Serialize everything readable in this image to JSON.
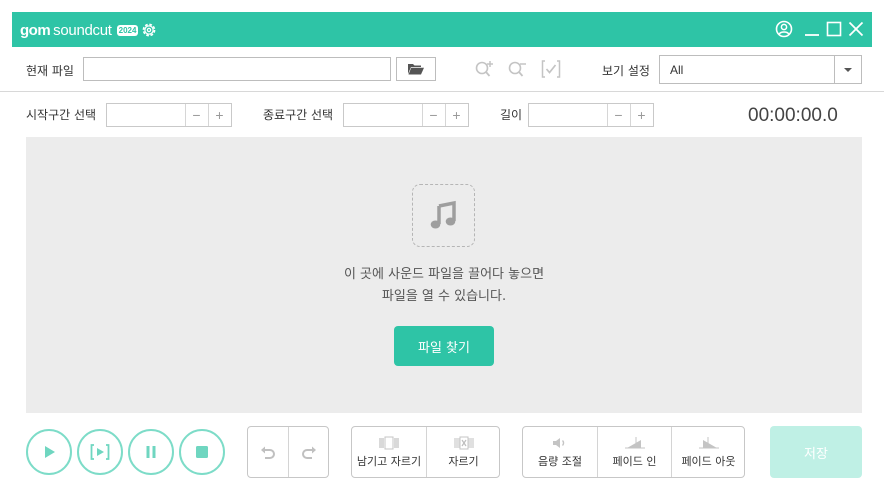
{
  "titlebar": {
    "logo_bold": "gom",
    "logo_light": "soundcut",
    "logo_badge": "2024"
  },
  "file_row": {
    "current_file_label": "현재 파일",
    "current_file_value": "",
    "view_settings_label": "보기 설정",
    "view_settings_value": "All"
  },
  "range_row": {
    "start_label": "시작구간 선택",
    "end_label": "종료구간 선택",
    "length_label": "길이",
    "minus": "−",
    "plus": "+",
    "time_display": "00:00:00.0"
  },
  "dropzone": {
    "line1": "이 곳에 사운드 파일을 끌어다 놓으면",
    "line2": "파일을 열 수 있습니다.",
    "find_button": "파일 찾기"
  },
  "bottom": {
    "keep_and_cut": "남기고 자르기",
    "cut": "자르기",
    "volume_adjust": "음량 조절",
    "fade_in": "페이드 인",
    "fade_out": "페이드 아웃",
    "save": "저장"
  },
  "colors": {
    "accent": "#2ec4a6",
    "accent_light": "#7ddcc8",
    "save_disabled": "#bff0e5",
    "dropzone_bg": "#ececec"
  }
}
